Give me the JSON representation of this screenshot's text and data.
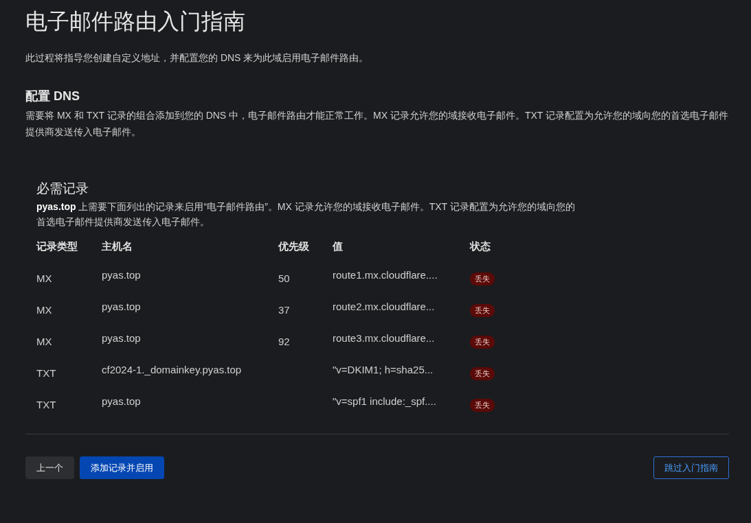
{
  "title": "电子邮件路由入门指南",
  "intro": "此过程将指导您创建自定义地址，并配置您的 DNS 来为此域启用电子邮件路由。",
  "section": {
    "heading": "配置 DNS",
    "description": "需要将 MX 和 TXT 记录的组合添加到您的 DNS 中，电子邮件路由才能正常工作。MX 记录允许您的域接收电子邮件。TXT 记录配置为允许您的域向您的首选电子邮件提供商发送传入电子邮件。"
  },
  "records": {
    "heading": "必需记录",
    "description": "**pyas.top** 上需要下面列出的记录来启用“电子邮件路由”。MX 记录允许您的域接收电子邮件。TXT 记录配置为允许您的域向您的首选电子邮件提供商发送传入电子邮件。",
    "columns": [
      "记录类型",
      "主机名",
      "优先级",
      "值",
      "状态"
    ],
    "rows": [
      {
        "type": "MX",
        "host": "pyas.top",
        "priority": "50",
        "value": "route1.mx.cloudflare....",
        "status": "丢失"
      },
      {
        "type": "MX",
        "host": "pyas.top",
        "priority": "37",
        "value": "route2.mx.cloudflare...",
        "status": "丢失"
      },
      {
        "type": "MX",
        "host": "pyas.top",
        "priority": "92",
        "value": "route3.mx.cloudflare...",
        "status": "丢失"
      },
      {
        "type": "TXT",
        "host": "cf2024-1._domainkey.pyas.top",
        "value": "\"v=DKIM1; h=sha25...",
        "status": "丢失"
      },
      {
        "type": "TXT",
        "host": "pyas.top",
        "value": "\"v=spf1 include:_spf....",
        "status": "丢失"
      }
    ]
  },
  "buttons": [
    {
      "label": "上一个",
      "kind": "secondary"
    },
    {
      "label": "添加记录并启用",
      "kind": "primary"
    },
    {
      "label": "跳过入门指南",
      "kind": "outline"
    }
  ]
}
